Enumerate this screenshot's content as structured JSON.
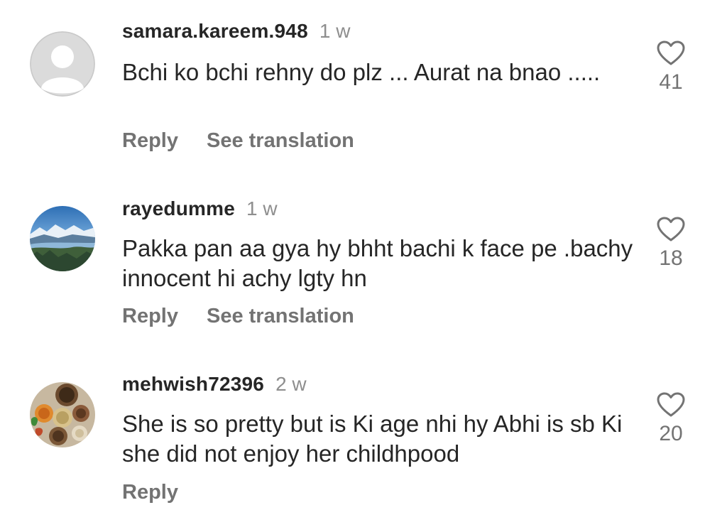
{
  "comments": [
    {
      "username": "samara.kareem.948",
      "time": "1 w",
      "text": "Bchi ko bchi rehny do plz ... Aurat na bnao .....",
      "reply": "Reply",
      "translate": "See translation",
      "likes": "41",
      "avatar": "default-avatar",
      "like_icon": "heart-outline-icon"
    },
    {
      "username": "rayedumme",
      "time": "1 w",
      "text": "Pakka pan aa gya hy bhht bachi k face pe .bachy innocent hi achy lgty hn",
      "reply": "Reply",
      "translate": "See translation",
      "likes": "18",
      "avatar": "mountain-lake-photo",
      "like_icon": "heart-outline-icon"
    },
    {
      "username": "mehwish72396",
      "time": "2 w",
      "text": "She is so pretty but is Ki age nhi hy Abhi is sb Ki she did not enjoy her childhpood",
      "reply": "Reply",
      "likes": "20",
      "avatar": "food-bowls-photo",
      "like_icon": "heart-outline-icon"
    }
  ],
  "colors": {
    "primary_text": "#262626",
    "secondary_text": "#8e8e8e",
    "action_text": "#737373",
    "default_avatar_bg": "#dbdbdb"
  }
}
